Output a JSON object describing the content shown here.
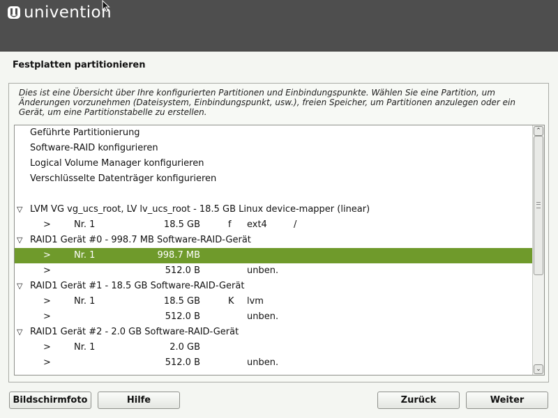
{
  "header": {
    "logo_text": "univention",
    "logo_icon": "univention-logo-icon",
    "cursor_icon": "mouse-pointer-icon"
  },
  "page": {
    "title": "Festplatten partitionieren",
    "intro": "Dies ist eine Übersicht über Ihre konfigurierten Partitionen und Einbindungspunkte. Wählen Sie eine Partition, um Änderungen vorzunehmen (Dateisystem, Einbindungspunkt, usw.), freien Speicher, um Partitionen anzulegen oder ein Gerät, um eine Partitionstabelle zu erstellen."
  },
  "list": {
    "actions": [
      "Geführte Partitionierung",
      "Software-RAID konfigurieren",
      "Logical Volume Manager konfigurieren",
      "Verschlüsselte Datenträger konfigurieren"
    ],
    "devices": [
      {
        "label": "LVM VG vg_ucs_root, LV lv_ucs_root - 18.5 GB Linux device-mapper (linear)",
        "partitions": [
          {
            "arrow": ">",
            "nr": "Nr. 1",
            "size": "18.5 GB",
            "flag": "f",
            "fs": "ext4",
            "mount": "/"
          }
        ]
      },
      {
        "label": "RAID1 Gerät #0 - 998.7 MB Software-RAID-Gerät",
        "partitions": [
          {
            "arrow": ">",
            "nr": "Nr. 1",
            "size": "998.7 MB",
            "flag": "",
            "fs": "",
            "mount": "",
            "selected": true
          },
          {
            "arrow": ">",
            "nr": "",
            "size": "512.0 B",
            "flag": "",
            "fs": "unben.",
            "mount": ""
          }
        ]
      },
      {
        "label": "RAID1 Gerät #1 - 18.5 GB Software-RAID-Gerät",
        "partitions": [
          {
            "arrow": ">",
            "nr": "Nr. 1",
            "size": "18.5 GB",
            "flag": "K",
            "fs": "lvm",
            "mount": ""
          },
          {
            "arrow": ">",
            "nr": "",
            "size": "512.0 B",
            "flag": "",
            "fs": "unben.",
            "mount": ""
          }
        ]
      },
      {
        "label": "RAID1 Gerät #2 - 2.0 GB Software-RAID-Gerät",
        "partitions": [
          {
            "arrow": ">",
            "nr": "Nr. 1",
            "size": "2.0 GB",
            "flag": "",
            "fs": "",
            "mount": ""
          },
          {
            "arrow": ">",
            "nr": "",
            "size": "512.0 B",
            "flag": "",
            "fs": "unben.",
            "mount": ""
          }
        ]
      }
    ],
    "expander_glyph": "▽",
    "scroll_up_glyph": "⌃",
    "scroll_down_glyph": "⌄"
  },
  "buttons": {
    "screenshot": "Bildschirmfoto",
    "help": "Hilfe",
    "back": "Zurück",
    "next": "Weiter"
  },
  "colors": {
    "header_bg": "#4e4e4e",
    "selection": "#6f9a2b",
    "page_bg": "#f4f6f2"
  }
}
